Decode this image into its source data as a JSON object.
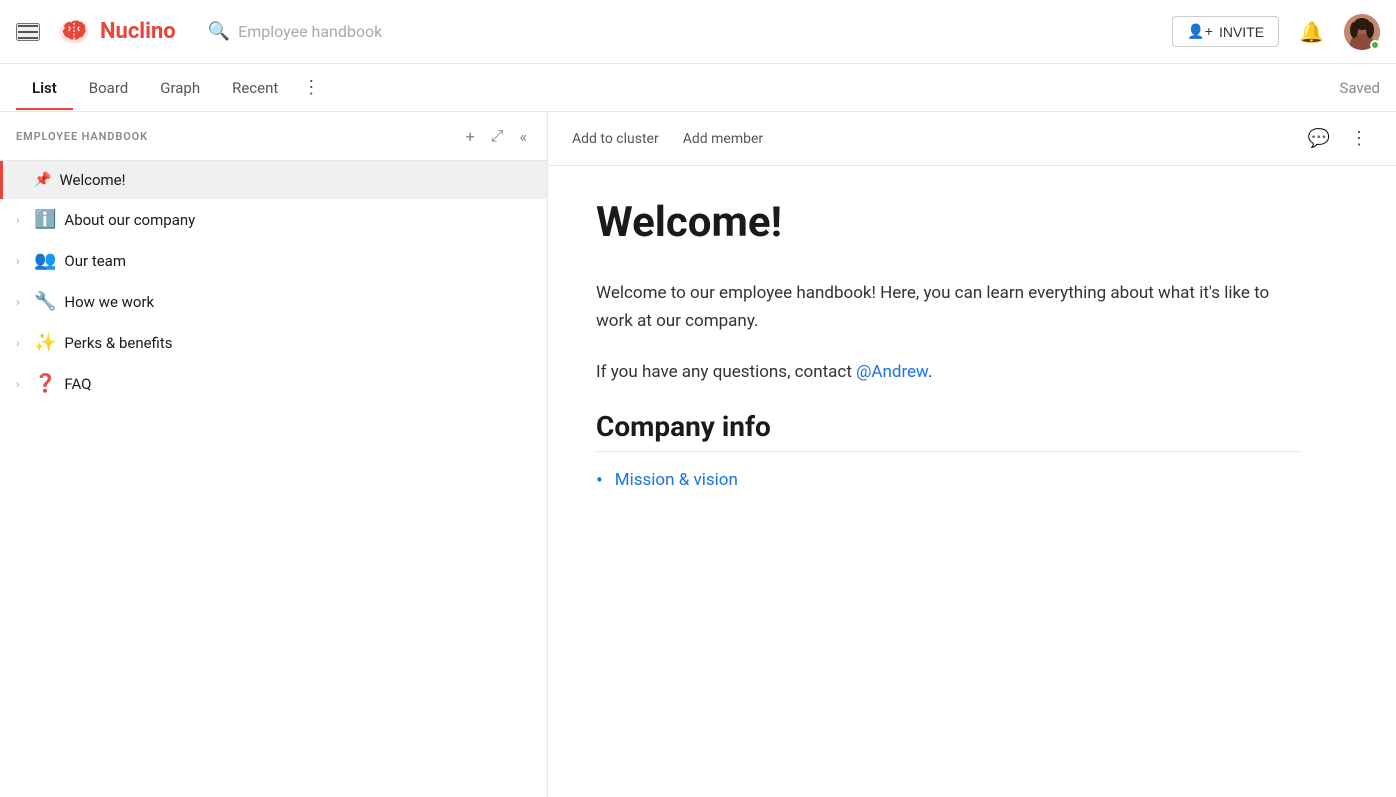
{
  "topnav": {
    "logo_text": "Nuclino",
    "search_placeholder": "Employee handbook",
    "invite_label": "INVITE",
    "saved_label": "Saved"
  },
  "tabs": [
    {
      "id": "list",
      "label": "List",
      "active": true
    },
    {
      "id": "board",
      "label": "Board",
      "active": false
    },
    {
      "id": "graph",
      "label": "Graph",
      "active": false
    },
    {
      "id": "recent",
      "label": "Recent",
      "active": false
    }
  ],
  "sidebar": {
    "title": "EMPLOYEE HANDBOOK",
    "items": [
      {
        "id": "welcome",
        "label": "Welcome!",
        "emoji": "📌",
        "type": "pin",
        "active": true,
        "chevron": ""
      },
      {
        "id": "about",
        "label": "About our company",
        "emoji": "ℹ️",
        "chevron": "›",
        "active": false
      },
      {
        "id": "team",
        "label": "Our team",
        "emoji": "👥",
        "chevron": "›",
        "active": false
      },
      {
        "id": "how",
        "label": "How we work",
        "emoji": "🔧",
        "chevron": "›",
        "active": false
      },
      {
        "id": "perks",
        "label": "Perks & benefits",
        "emoji": "✨",
        "chevron": "›",
        "active": false
      },
      {
        "id": "faq",
        "label": "FAQ",
        "emoji": "❓",
        "chevron": "›",
        "active": false
      }
    ]
  },
  "content": {
    "toolbar": {
      "add_cluster": "Add to cluster",
      "add_member": "Add member"
    },
    "title": "Welcome!",
    "paragraph1": "Welcome to our employee handbook! Here, you can learn everything about what it's like to work at our company.",
    "paragraph2_prefix": "If you have any questions, contact ",
    "paragraph2_link": "@Andrew",
    "paragraph2_suffix": ".",
    "section_title": "Company info",
    "bullet_link": "Mission & vision"
  },
  "icons": {
    "hamburger": "☰",
    "search": "🔍",
    "bell": "🔔",
    "add": "+",
    "expand": "⤢",
    "collapse": "«",
    "chat": "💬",
    "more_vert": "⋮",
    "checkbox": "☐"
  }
}
